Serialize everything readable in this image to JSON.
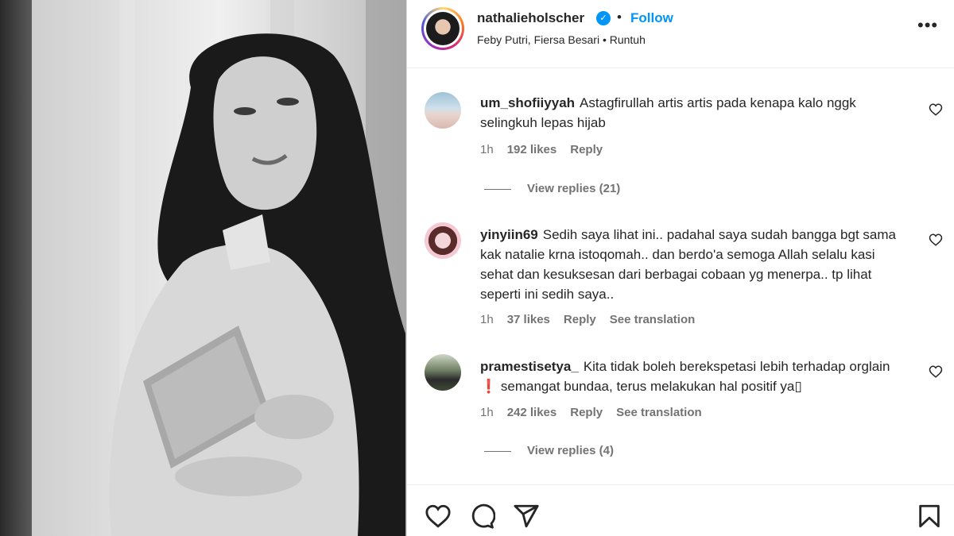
{
  "post": {
    "username": "nathalieholscher",
    "verified_icon": "verified-badge-icon",
    "separator": "•",
    "follow_label": "Follow",
    "music": "Feby Putri, Fiersa Besari • Runtuh",
    "more_label": "•••"
  },
  "comments": [
    {
      "user": "um_shofiiyyah",
      "text": "Astagfirullah artis artis pada kenapa kalo nggk selingkuh lepas hijab",
      "time": "1h",
      "likes": "192 likes",
      "reply": "Reply",
      "view_replies": "View replies (21)"
    },
    {
      "user": "yinyiin69",
      "text": "Sedih saya lihat ini.. padahal saya sudah bangga bgt sama kak natalie krna istoqomah.. dan berdo'a semoga Allah selalu kasi sehat dan kesuksesan dari berbagai cobaan yg menerpa.. tp lihat seperti ini sedih saya..",
      "time": "1h",
      "likes": "37 likes",
      "reply": "Reply",
      "see_translation": "See translation"
    },
    {
      "user": "pramestisetya_",
      "text": "Kita tidak boleh berekspetasi lebih terhadap orglain ❗ semangat bundaa, terus melakukan hal positif ya▯",
      "time": "1h",
      "likes": "242 likes",
      "reply": "Reply",
      "see_translation": "See translation",
      "view_replies": "View replies (4)"
    }
  ],
  "icons": {
    "like": "heart-icon",
    "comment": "comment-icon",
    "share": "share-icon",
    "save": "bookmark-icon"
  },
  "colors": {
    "link_blue": "#0095f6",
    "muted": "#737373",
    "text": "#262626"
  }
}
